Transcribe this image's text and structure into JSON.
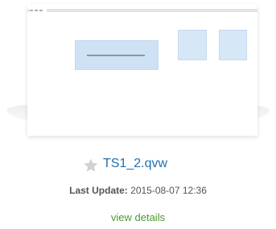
{
  "document": {
    "title": "TS1_2.qvw",
    "last_update_label": "Last Update:",
    "last_update_value": "2015-08-07 12:36",
    "details_link": "view details",
    "favorite_icon": "star-icon"
  },
  "colors": {
    "title_link": "#1f6fb0",
    "details_link": "#4a9a2f",
    "thumbnail_box": "#cfe2f5",
    "star": "#c9c9c9"
  }
}
